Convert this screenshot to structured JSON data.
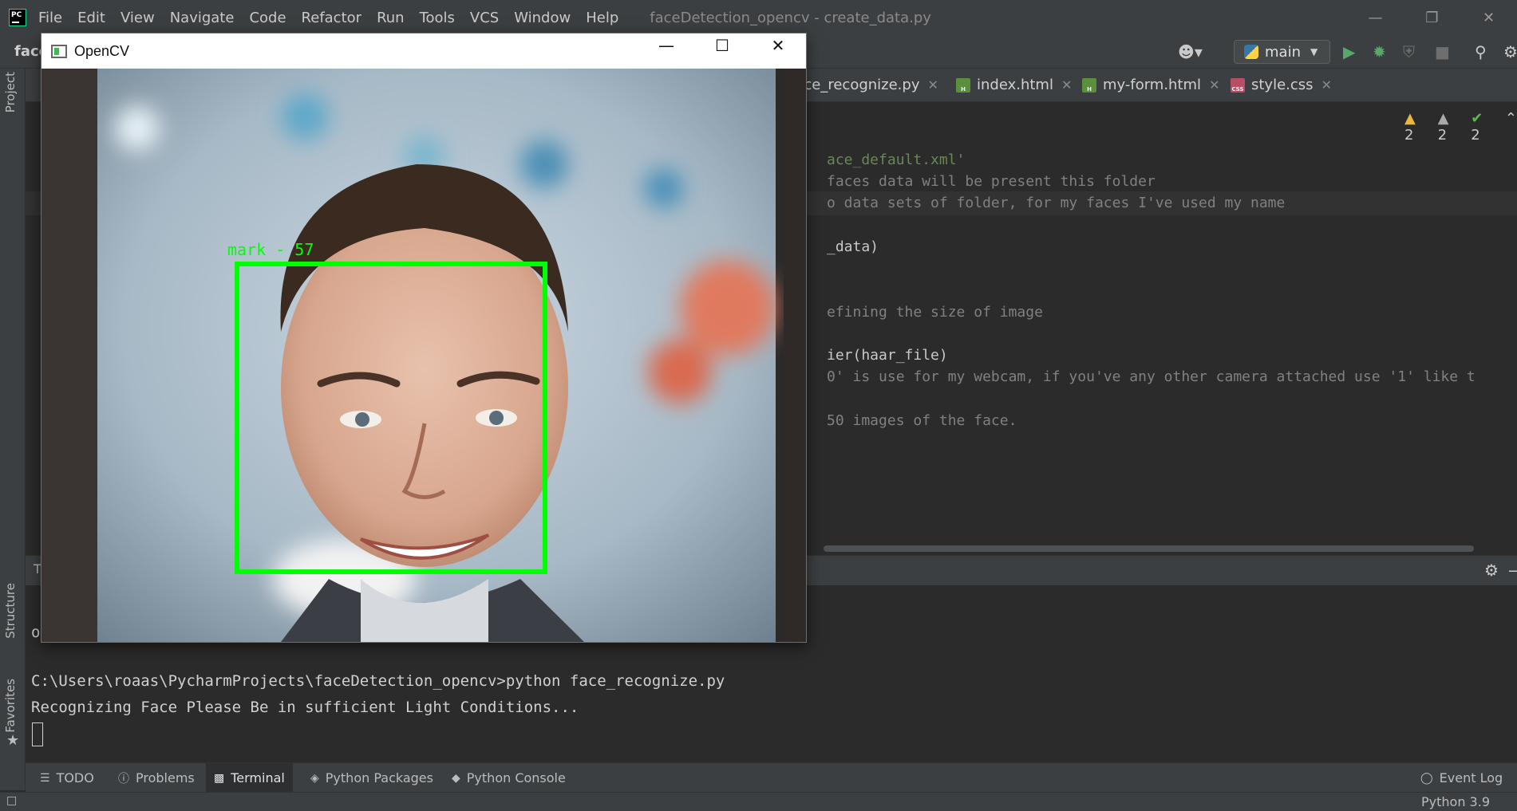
{
  "ide": {
    "menu": [
      "File",
      "Edit",
      "View",
      "Navigate",
      "Code",
      "Refactor",
      "Run",
      "Tools",
      "VCS",
      "Window",
      "Help"
    ],
    "window_title": "faceDetection_opencv - create_data.py",
    "project_crumb": "face",
    "run_config": "main",
    "left_tabs": {
      "project": "Project",
      "structure": "Structure",
      "favorites": "Favorites"
    },
    "editor_tabs": [
      {
        "label": "face_recognize.py",
        "icon": "python-file-icon"
      },
      {
        "label": "index.html",
        "icon": "html-file-icon"
      },
      {
        "label": "my-form.html",
        "icon": "html-file-icon"
      },
      {
        "label": "style.css",
        "icon": "css-file-icon"
      }
    ],
    "inspections": {
      "warnings": "2",
      "weak_warnings": "2",
      "ok": "2"
    },
    "code_fragments": [
      {
        "text": "ace_default.xml'",
        "kind": "str"
      },
      {
        "text": "faces data will be present this folder",
        "kind": "com"
      },
      {
        "text": "o data sets of folder, for my faces I've used my name",
        "kind": "com"
      },
      {
        "text": "_data)",
        "kind": "def"
      },
      {
        "text": "efining the size of image",
        "kind": "com"
      },
      {
        "text": "ier(haar_file)",
        "kind": "def"
      },
      {
        "text": "0' is use for my webcam, if you've any other camera attached use '1' like t",
        "kind": "com"
      },
      {
        "text": "50 images of the face.",
        "kind": "com"
      }
    ],
    "terminal": {
      "tab_label": "T",
      "first_line_char": "o",
      "lines": [
        "C:\\Users\\roaas\\PycharmProjects\\faceDetection_opencv>python face_recognize.py",
        "Recognizing Face Please Be in sufficient Light Conditions..."
      ]
    },
    "bottom_tabs": [
      {
        "label": "TODO",
        "icon": "list-icon"
      },
      {
        "label": "Problems",
        "icon": "alert-icon"
      },
      {
        "label": "Terminal",
        "icon": "terminal-icon",
        "active": true
      },
      {
        "label": "Python Packages",
        "icon": "layers-icon"
      },
      {
        "label": "Python Console",
        "icon": "python-icon"
      }
    ],
    "event_log": "Event Log",
    "interpreter": "Python 3.9"
  },
  "opencv": {
    "title": "OpenCV",
    "face_label": "mark - 57",
    "box_color": "#00ff00"
  }
}
